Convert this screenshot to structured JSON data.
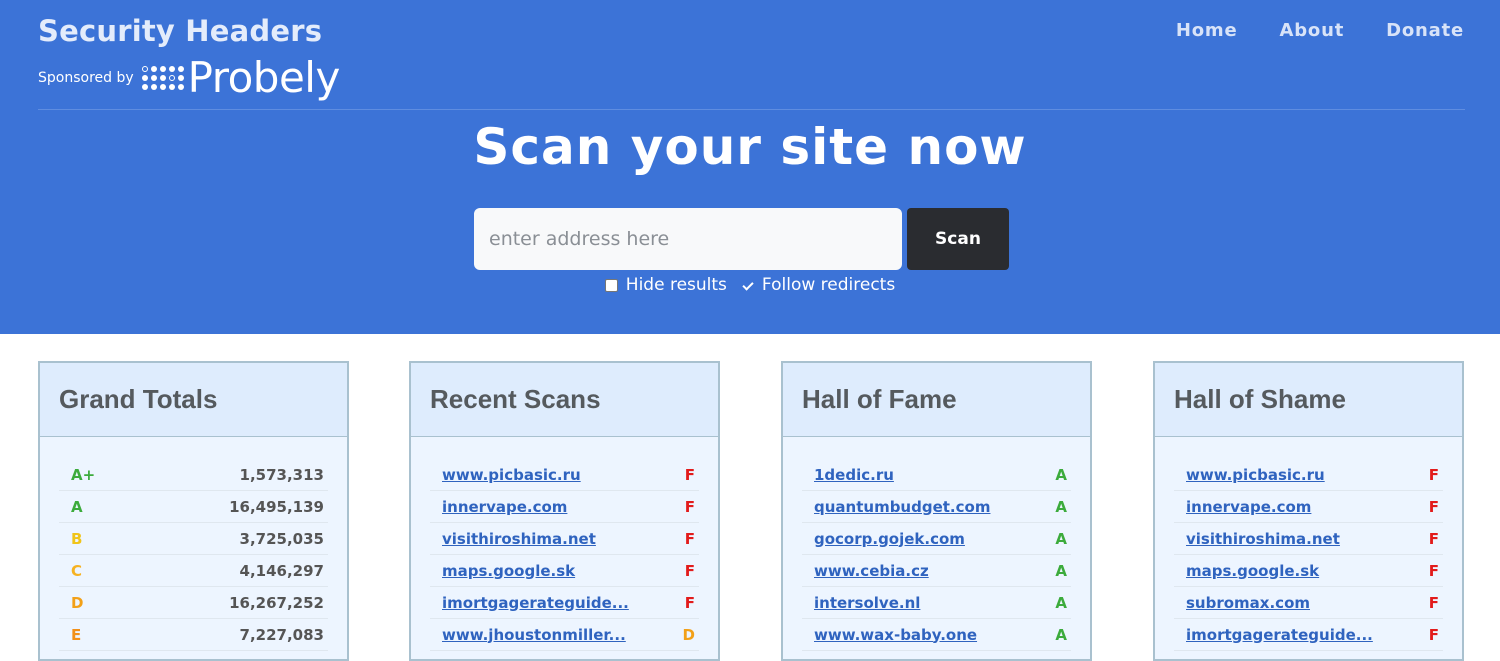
{
  "header": {
    "title": "Security Headers",
    "sponsor_label": "Sponsored by",
    "sponsor_logo_text": "Probely",
    "nav": [
      {
        "label": "Home"
      },
      {
        "label": "About"
      },
      {
        "label": "Donate"
      }
    ]
  },
  "hero": {
    "headline": "Scan your site now",
    "search_placeholder": "enter address here",
    "search_value": "",
    "scan_label": "Scan",
    "hide_results_label": "Hide results",
    "hide_results_checked": false,
    "follow_redirects_label": "Follow redirects",
    "follow_redirects_checked": true
  },
  "panels": {
    "grand_totals": {
      "title": "Grand Totals",
      "rows": [
        {
          "grade": "A+",
          "count": "1,573,313"
        },
        {
          "grade": "A",
          "count": "16,495,139"
        },
        {
          "grade": "B",
          "count": "3,725,035"
        },
        {
          "grade": "C",
          "count": "4,146,297"
        },
        {
          "grade": "D",
          "count": "16,267,252"
        },
        {
          "grade": "E",
          "count": "7,227,083"
        }
      ]
    },
    "recent_scans": {
      "title": "Recent Scans",
      "rows": [
        {
          "site": "www.picbasic.ru",
          "grade": "F"
        },
        {
          "site": "innervape.com",
          "grade": "F"
        },
        {
          "site": "visithiroshima.net",
          "grade": "F"
        },
        {
          "site": "maps.google.sk",
          "grade": "F"
        },
        {
          "site": "imortgagerateguide...",
          "grade": "F"
        },
        {
          "site": "www.jhoustonmiller...",
          "grade": "D"
        }
      ]
    },
    "hall_of_fame": {
      "title": "Hall of Fame",
      "rows": [
        {
          "site": "1dedic.ru",
          "grade": "A"
        },
        {
          "site": "quantumbudget.com",
          "grade": "A"
        },
        {
          "site": "gocorp.gojek.com",
          "grade": "A"
        },
        {
          "site": "www.cebia.cz",
          "grade": "A"
        },
        {
          "site": "intersolve.nl",
          "grade": "A"
        },
        {
          "site": "www.wax-baby.one",
          "grade": "A"
        }
      ]
    },
    "hall_of_shame": {
      "title": "Hall of Shame",
      "rows": [
        {
          "site": "www.picbasic.ru",
          "grade": "F"
        },
        {
          "site": "innervape.com",
          "grade": "F"
        },
        {
          "site": "visithiroshima.net",
          "grade": "F"
        },
        {
          "site": "maps.google.sk",
          "grade": "F"
        },
        {
          "site": "subromax.com",
          "grade": "F"
        },
        {
          "site": "imortgagerateguide...",
          "grade": "F"
        }
      ]
    }
  },
  "colors": {
    "hero_background": "#3c73d7",
    "scan_button": "#2a2c30",
    "panel_background": "#edf5ff",
    "panel_header": "#deecfd",
    "grade_a": "#3cab3c",
    "grade_b": "#f0c419",
    "grade_c": "#f6b222",
    "grade_d": "#f2a018",
    "grade_e": "#f29018",
    "grade_f": "#e21b1b",
    "link": "#2f63bf"
  }
}
